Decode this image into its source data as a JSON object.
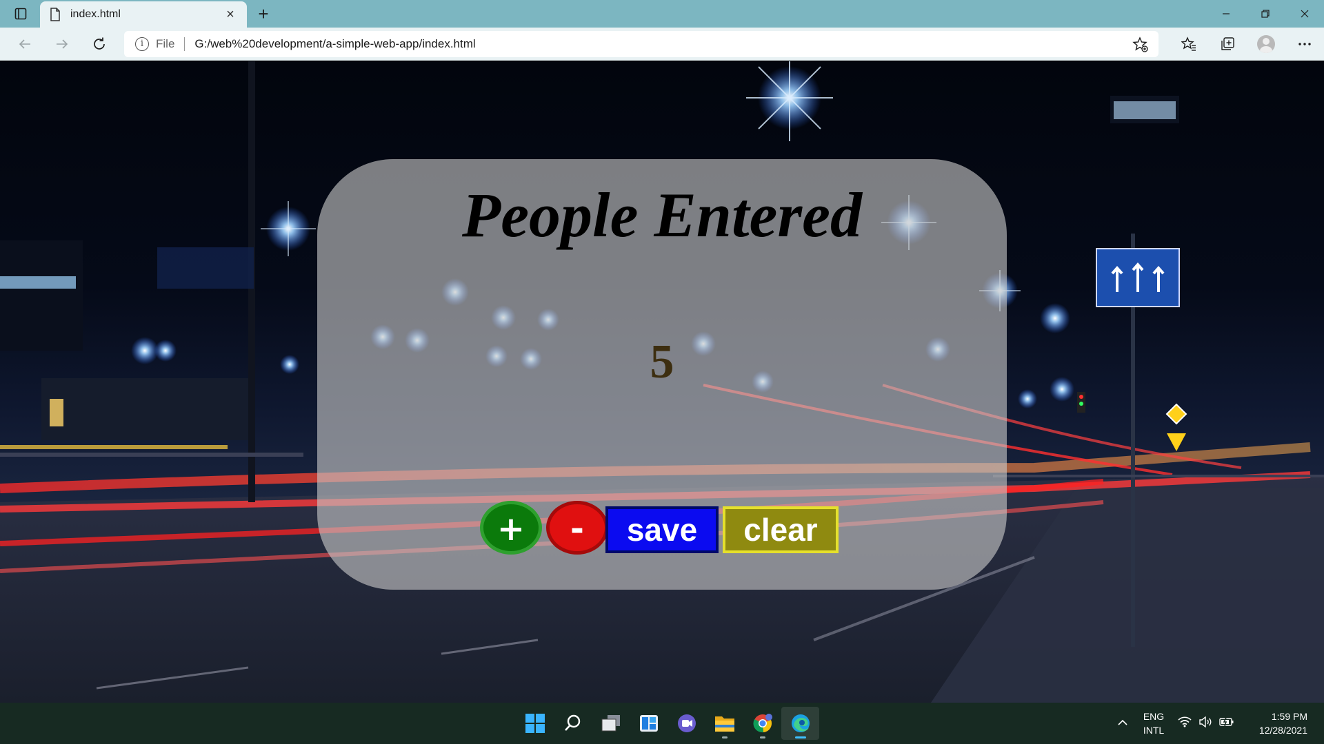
{
  "browser": {
    "tab_title": "index.html",
    "new_tab_label": "+",
    "address": {
      "scheme_label": "File",
      "url": "G:/web%20development/a-simple-web-app/index.html"
    }
  },
  "page": {
    "heading": "People Entered",
    "count": "5",
    "buttons": {
      "increment_label": "+",
      "decrement_label": "-",
      "save_label": "save",
      "clear_label": "clear"
    },
    "colors": {
      "increment": "#0b7a0b",
      "decrement": "#e01010",
      "save": "#0b0bf0",
      "clear": "#8f8a10"
    }
  },
  "taskbar": {
    "apps": [
      "start-icon",
      "search-icon",
      "task-view-icon",
      "widgets-icon",
      "teams-chat-icon",
      "file-explorer-icon",
      "chrome-icon",
      "edge-icon"
    ],
    "language_line1": "ENG",
    "language_line2": "INTL",
    "time": "1:59 PM",
    "date": "12/28/2021"
  }
}
